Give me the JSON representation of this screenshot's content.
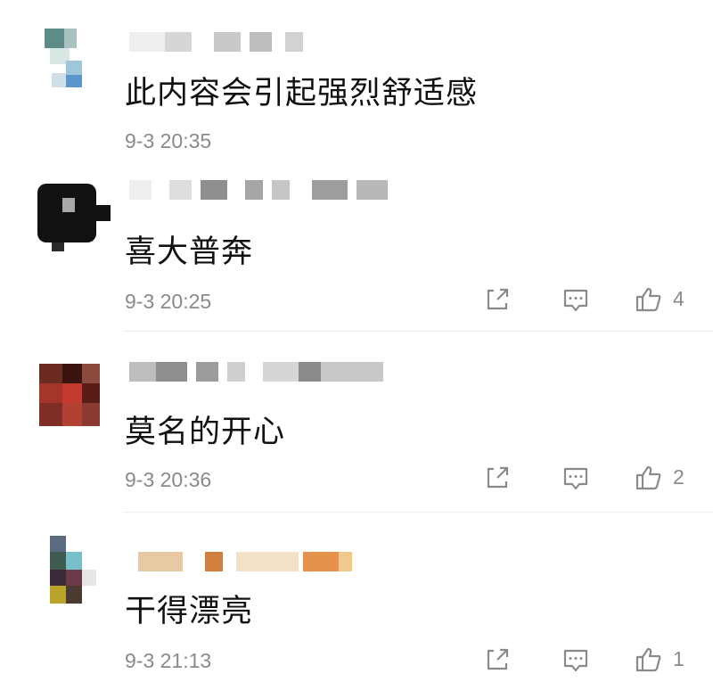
{
  "comments": [
    {
      "text": "此内容会引起强烈舒适感",
      "time": "9-3 20:35"
    },
    {
      "text": "喜大普奔",
      "time": "9-3 20:25",
      "likes": "4"
    },
    {
      "text": "莫名的开心",
      "time": "9-3 20:36",
      "likes": "2"
    },
    {
      "text": "干得漂亮",
      "time": "9-3 21:13",
      "likes": "1"
    }
  ],
  "icons": {
    "share": "share-icon",
    "reply": "reply-icon",
    "like": "thumbs-up-icon"
  },
  "colors": {
    "text": "#111111",
    "meta": "#8a8a8a",
    "icon": "#8a8a8a",
    "divider": "#ececec"
  }
}
